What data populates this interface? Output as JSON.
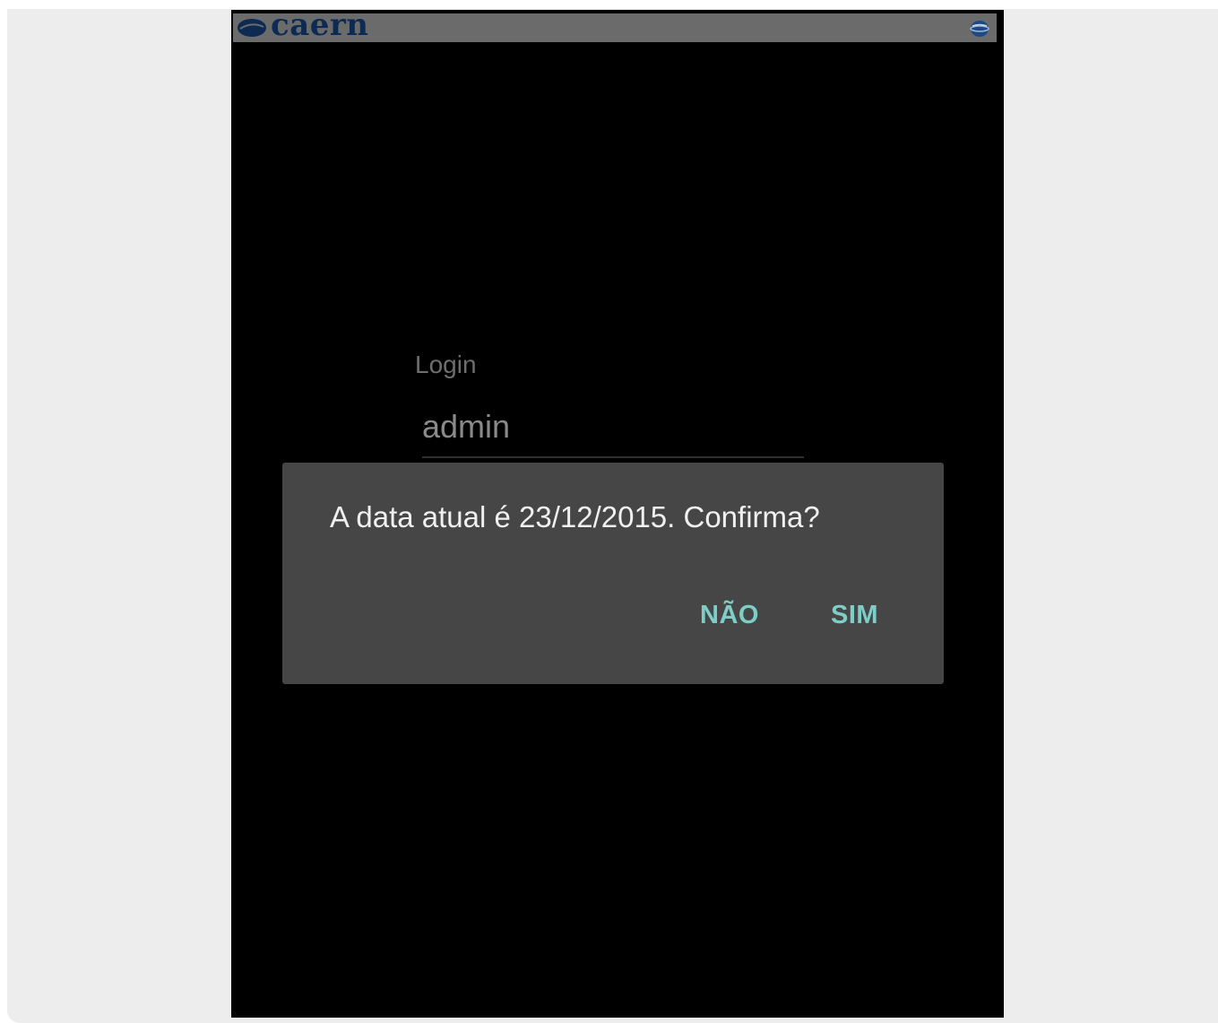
{
  "app_bar": {
    "logo_text": "caern",
    "logo_icon": "caern-logo-mark",
    "right_icon": "globe-icon",
    "bar_color": "#6b6b6b",
    "logo_color": "#0d2a52"
  },
  "login": {
    "label": "Login",
    "value": "admin"
  },
  "dialog": {
    "message": "A data atual é 23/12/2015. Confirma?",
    "negative_label": "NÃO",
    "positive_label": "SIM",
    "button_color": "#7ecdc6",
    "background_color": "#464646"
  }
}
